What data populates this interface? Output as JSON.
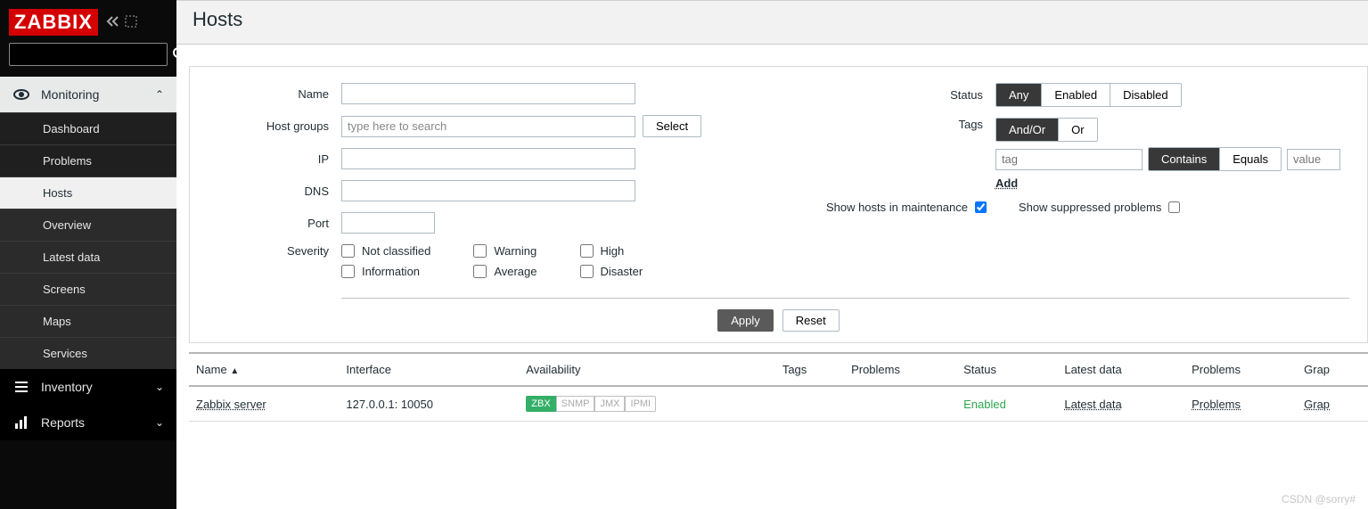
{
  "logo": "ZABBIX",
  "page_title": "Hosts",
  "sidebar": {
    "sections": [
      {
        "icon": "eye-icon",
        "label": "Monitoring",
        "expanded": true,
        "items": [
          {
            "label": "Dashboard",
            "active": false
          },
          {
            "label": "Problems",
            "active": false
          },
          {
            "label": "Hosts",
            "active": true
          },
          {
            "label": "Overview",
            "active": false
          },
          {
            "label": "Latest data",
            "active": false
          },
          {
            "label": "Screens",
            "active": false
          },
          {
            "label": "Maps",
            "active": false
          },
          {
            "label": "Services",
            "active": false
          }
        ]
      },
      {
        "icon": "list-icon",
        "label": "Inventory",
        "expanded": false,
        "items": []
      },
      {
        "icon": "chart-icon",
        "label": "Reports",
        "expanded": false,
        "items": []
      }
    ]
  },
  "filter": {
    "labels": {
      "name": "Name",
      "host_groups": "Host groups",
      "ip": "IP",
      "dns": "DNS",
      "port": "Port",
      "severity": "Severity",
      "status": "Status",
      "tags": "Tags",
      "maintenance": "Show hosts in maintenance",
      "suppressed": "Show suppressed problems"
    },
    "host_groups_placeholder": "type here to search",
    "select_btn": "Select",
    "status_options": [
      "Any",
      "Enabled",
      "Disabled"
    ],
    "status_active": 0,
    "tag_mode_options": [
      "And/Or",
      "Or"
    ],
    "tag_mode_active": 0,
    "tag_placeholder": "tag",
    "tag_value_placeholder": "value",
    "tag_match_options": [
      "Contains",
      "Equals"
    ],
    "tag_match_active": 0,
    "add_link": "Add",
    "maintenance_checked": true,
    "suppressed_checked": false,
    "severity": {
      "col1": [
        "Not classified",
        "Information"
      ],
      "col2": [
        "Warning",
        "Average"
      ],
      "col3": [
        "High",
        "Disaster"
      ]
    },
    "apply": "Apply",
    "reset": "Reset"
  },
  "table": {
    "headers": [
      "Name",
      "Interface",
      "Availability",
      "Tags",
      "Problems",
      "Status",
      "Latest data",
      "Problems",
      "Grap"
    ],
    "sorted_col": 0,
    "rows": [
      {
        "name": "Zabbix server",
        "interface": "127.0.0.1: 10050",
        "availability": [
          {
            "label": "ZBX",
            "state": "green"
          },
          {
            "label": "SNMP",
            "state": "off"
          },
          {
            "label": "JMX",
            "state": "off"
          },
          {
            "label": "IPMI",
            "state": "off"
          }
        ],
        "tags": "",
        "problems": "",
        "status": "Enabled",
        "latest_data": "Latest data",
        "problems_link": "Problems",
        "graphs": "Grap"
      }
    ]
  },
  "watermark": "CSDN @sorry#"
}
